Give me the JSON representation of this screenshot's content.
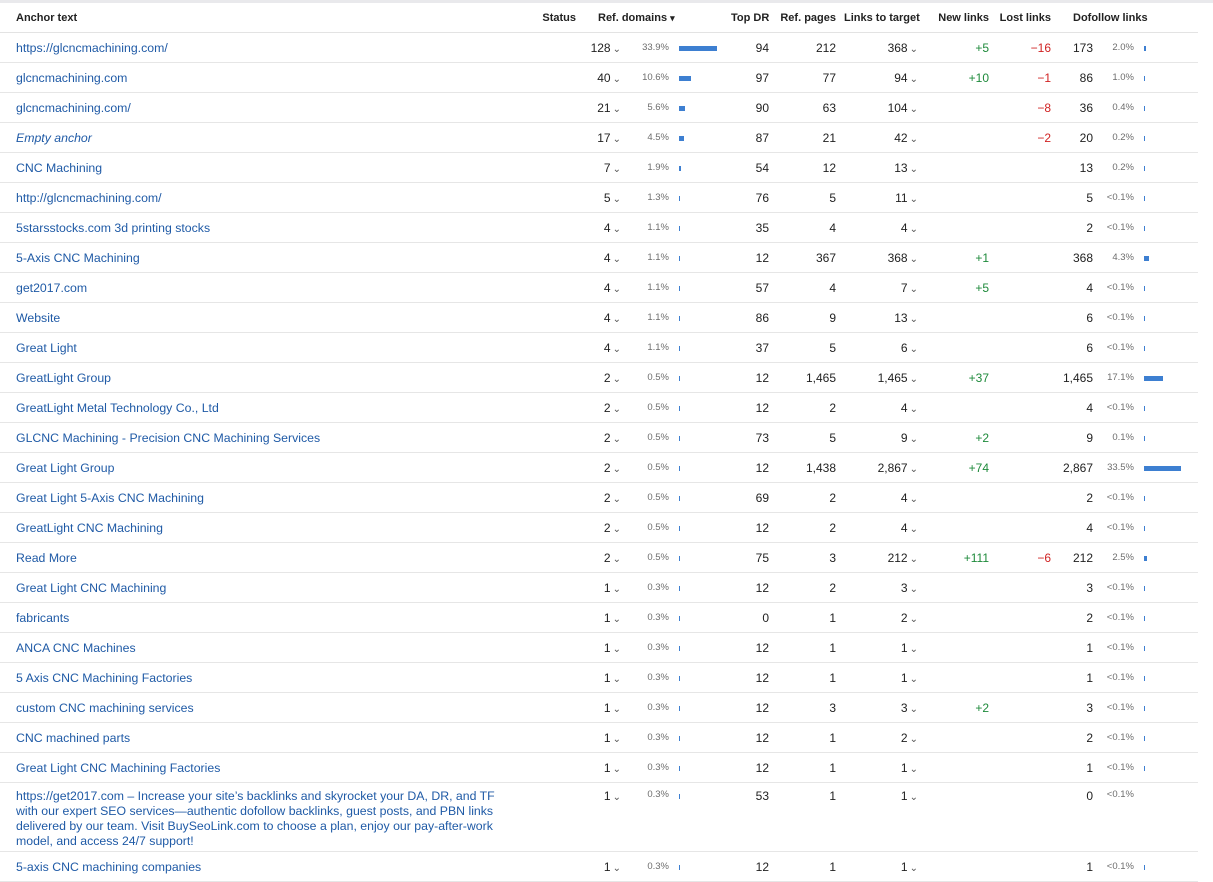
{
  "columns": {
    "anchor": "Anchor text",
    "status": "Status",
    "ref_domains": "Ref. domains",
    "top_dr": "Top DR",
    "ref_pages": "Ref. pages",
    "links_to_target": "Links to target",
    "new_links": "New links",
    "lost_links": "Lost links",
    "dofollow_links": "Dofollow links"
  },
  "sort_caret": "▾",
  "dropdown_glyph": "⌄",
  "colors": {
    "link": "#1f5aa6",
    "bar": "#3d7fd1",
    "positive": "#1e8a3b",
    "negative": "#d02323"
  },
  "rows": [
    {
      "anchor": "https://glcncmachining.com/",
      "refd": "128",
      "refd_pct": "33.9%",
      "refd_share": 33.9,
      "top_dr": "94",
      "ref_pages": "212",
      "ltt": "368",
      "new": "+5",
      "lost": "−16",
      "dof": "173",
      "dof_pct": "2.0%",
      "dof_share": 2.0
    },
    {
      "anchor": "glcncmachining.com",
      "refd": "40",
      "refd_pct": "10.6%",
      "refd_share": 10.6,
      "top_dr": "97",
      "ref_pages": "77",
      "ltt": "94",
      "new": "+10",
      "lost": "−1",
      "dof": "86",
      "dof_pct": "1.0%",
      "dof_share": 1.0
    },
    {
      "anchor": "glcncmachining.com/",
      "refd": "21",
      "refd_pct": "5.6%",
      "refd_share": 5.6,
      "top_dr": "90",
      "ref_pages": "63",
      "ltt": "104",
      "new": "",
      "lost": "−8",
      "dof": "36",
      "dof_pct": "0.4%",
      "dof_share": 0.4
    },
    {
      "anchor": "Empty anchor",
      "empty": true,
      "refd": "17",
      "refd_pct": "4.5%",
      "refd_share": 4.5,
      "top_dr": "87",
      "ref_pages": "21",
      "ltt": "42",
      "new": "",
      "lost": "−2",
      "dof": "20",
      "dof_pct": "0.2%",
      "dof_share": 0.2
    },
    {
      "anchor": "CNC Machining",
      "refd": "7",
      "refd_pct": "1.9%",
      "refd_share": 1.9,
      "top_dr": "54",
      "ref_pages": "12",
      "ltt": "13",
      "new": "",
      "lost": "",
      "dof": "13",
      "dof_pct": "0.2%",
      "dof_share": 0.2
    },
    {
      "anchor": "http://glcncmachining.com/",
      "refd": "5",
      "refd_pct": "1.3%",
      "refd_share": 1.3,
      "top_dr": "76",
      "ref_pages": "5",
      "ltt": "11",
      "new": "",
      "lost": "",
      "dof": "5",
      "dof_pct": "<0.1%",
      "dof_share": 0.05
    },
    {
      "anchor": "5starsstocks.com 3d printing stocks",
      "refd": "4",
      "refd_pct": "1.1%",
      "refd_share": 1.1,
      "top_dr": "35",
      "ref_pages": "4",
      "ltt": "4",
      "new": "",
      "lost": "",
      "dof": "2",
      "dof_pct": "<0.1%",
      "dof_share": 0.05
    },
    {
      "anchor": "5-Axis CNC Machining",
      "refd": "4",
      "refd_pct": "1.1%",
      "refd_share": 1.1,
      "top_dr": "12",
      "ref_pages": "367",
      "ltt": "368",
      "new": "+1",
      "lost": "",
      "dof": "368",
      "dof_pct": "4.3%",
      "dof_share": 4.3
    },
    {
      "anchor": "get2017.com",
      "refd": "4",
      "refd_pct": "1.1%",
      "refd_share": 1.1,
      "top_dr": "57",
      "ref_pages": "4",
      "ltt": "7",
      "new": "+5",
      "lost": "",
      "dof": "4",
      "dof_pct": "<0.1%",
      "dof_share": 0.05
    },
    {
      "anchor": "Website",
      "refd": "4",
      "refd_pct": "1.1%",
      "refd_share": 1.1,
      "top_dr": "86",
      "ref_pages": "9",
      "ltt": "13",
      "new": "",
      "lost": "",
      "dof": "6",
      "dof_pct": "<0.1%",
      "dof_share": 0.05
    },
    {
      "anchor": "Great Light",
      "refd": "4",
      "refd_pct": "1.1%",
      "refd_share": 1.1,
      "top_dr": "37",
      "ref_pages": "5",
      "ltt": "6",
      "new": "",
      "lost": "",
      "dof": "6",
      "dof_pct": "<0.1%",
      "dof_share": 0.05
    },
    {
      "anchor": "GreatLight Group",
      "refd": "2",
      "refd_pct": "0.5%",
      "refd_share": 0.5,
      "top_dr": "12",
      "ref_pages": "1,465",
      "ltt": "1,465",
      "new": "+37",
      "lost": "",
      "dof": "1,465",
      "dof_pct": "17.1%",
      "dof_share": 17.1
    },
    {
      "anchor": "GreatLight Metal Technology Co., Ltd",
      "refd": "2",
      "refd_pct": "0.5%",
      "refd_share": 0.5,
      "top_dr": "12",
      "ref_pages": "2",
      "ltt": "4",
      "new": "",
      "lost": "",
      "dof": "4",
      "dof_pct": "<0.1%",
      "dof_share": 0.05
    },
    {
      "anchor": "GLCNC Machining - Precision CNC Machining Services",
      "refd": "2",
      "refd_pct": "0.5%",
      "refd_share": 0.5,
      "top_dr": "73",
      "ref_pages": "5",
      "ltt": "9",
      "new": "+2",
      "lost": "",
      "dof": "9",
      "dof_pct": "0.1%",
      "dof_share": 0.1
    },
    {
      "anchor": "Great Light Group",
      "refd": "2",
      "refd_pct": "0.5%",
      "refd_share": 0.5,
      "top_dr": "12",
      "ref_pages": "1,438",
      "ltt": "2,867",
      "new": "+74",
      "lost": "",
      "dof": "2,867",
      "dof_pct": "33.5%",
      "dof_share": 33.5
    },
    {
      "anchor": "Great Light 5-Axis CNC Machining",
      "refd": "2",
      "refd_pct": "0.5%",
      "refd_share": 0.5,
      "top_dr": "69",
      "ref_pages": "2",
      "ltt": "4",
      "new": "",
      "lost": "",
      "dof": "2",
      "dof_pct": "<0.1%",
      "dof_share": 0.05
    },
    {
      "anchor": "GreatLight CNC Machining",
      "refd": "2",
      "refd_pct": "0.5%",
      "refd_share": 0.5,
      "top_dr": "12",
      "ref_pages": "2",
      "ltt": "4",
      "new": "",
      "lost": "",
      "dof": "4",
      "dof_pct": "<0.1%",
      "dof_share": 0.05
    },
    {
      "anchor": "Read More",
      "refd": "2",
      "refd_pct": "0.5%",
      "refd_share": 0.5,
      "top_dr": "75",
      "ref_pages": "3",
      "ltt": "212",
      "new": "+111",
      "lost": "−6",
      "dof": "212",
      "dof_pct": "2.5%",
      "dof_share": 2.5
    },
    {
      "anchor": "Great Light CNC Machining",
      "refd": "1",
      "refd_pct": "0.3%",
      "refd_share": 0.3,
      "top_dr": "12",
      "ref_pages": "2",
      "ltt": "3",
      "new": "",
      "lost": "",
      "dof": "3",
      "dof_pct": "<0.1%",
      "dof_share": 0.05
    },
    {
      "anchor": "fabricants",
      "refd": "1",
      "refd_pct": "0.3%",
      "refd_share": 0.3,
      "top_dr": "0",
      "ref_pages": "1",
      "ltt": "2",
      "new": "",
      "lost": "",
      "dof": "2",
      "dof_pct": "<0.1%",
      "dof_share": 0.05
    },
    {
      "anchor": "ANCA CNC Machines",
      "refd": "1",
      "refd_pct": "0.3%",
      "refd_share": 0.3,
      "top_dr": "12",
      "ref_pages": "1",
      "ltt": "1",
      "new": "",
      "lost": "",
      "dof": "1",
      "dof_pct": "<0.1%",
      "dof_share": 0.05
    },
    {
      "anchor": "5 Axis CNC Machining Factories",
      "refd": "1",
      "refd_pct": "0.3%",
      "refd_share": 0.3,
      "top_dr": "12",
      "ref_pages": "1",
      "ltt": "1",
      "new": "",
      "lost": "",
      "dof": "1",
      "dof_pct": "<0.1%",
      "dof_share": 0.05
    },
    {
      "anchor": "custom CNC machining services",
      "refd": "1",
      "refd_pct": "0.3%",
      "refd_share": 0.3,
      "top_dr": "12",
      "ref_pages": "3",
      "ltt": "3",
      "new": "+2",
      "lost": "",
      "dof": "3",
      "dof_pct": "<0.1%",
      "dof_share": 0.05
    },
    {
      "anchor": "CNC machined parts",
      "refd": "1",
      "refd_pct": "0.3%",
      "refd_share": 0.3,
      "top_dr": "12",
      "ref_pages": "1",
      "ltt": "2",
      "new": "",
      "lost": "",
      "dof": "2",
      "dof_pct": "<0.1%",
      "dof_share": 0.05
    },
    {
      "anchor": "Great Light CNC Machining Factories",
      "refd": "1",
      "refd_pct": "0.3%",
      "refd_share": 0.3,
      "top_dr": "12",
      "ref_pages": "1",
      "ltt": "1",
      "new": "",
      "lost": "",
      "dof": "1",
      "dof_pct": "<0.1%",
      "dof_share": 0.05
    },
    {
      "anchor": "https://get2017.com – Increase your site’s backlinks and skyrocket your DA, DR, and TF with our expert SEO services—authentic dofollow backlinks, guest posts, and PBN links delivered by our team. Visit BuySeoLink.com to choose a plan, enjoy our pay-after-work model, and access 24/7 support!",
      "tall": true,
      "refd": "1",
      "refd_pct": "0.3%",
      "refd_share": 0.3,
      "top_dr": "53",
      "ref_pages": "1",
      "ltt": "1",
      "new": "",
      "lost": "",
      "dof": "0",
      "dof_pct": "<0.1%",
      "dof_share": 0
    },
    {
      "anchor": "5-axis CNC machining companies",
      "refd": "1",
      "refd_pct": "0.3%",
      "refd_share": 0.3,
      "top_dr": "12",
      "ref_pages": "1",
      "ltt": "1",
      "new": "",
      "lost": "",
      "dof": "1",
      "dof_pct": "<0.1%",
      "dof_share": 0.05
    }
  ]
}
